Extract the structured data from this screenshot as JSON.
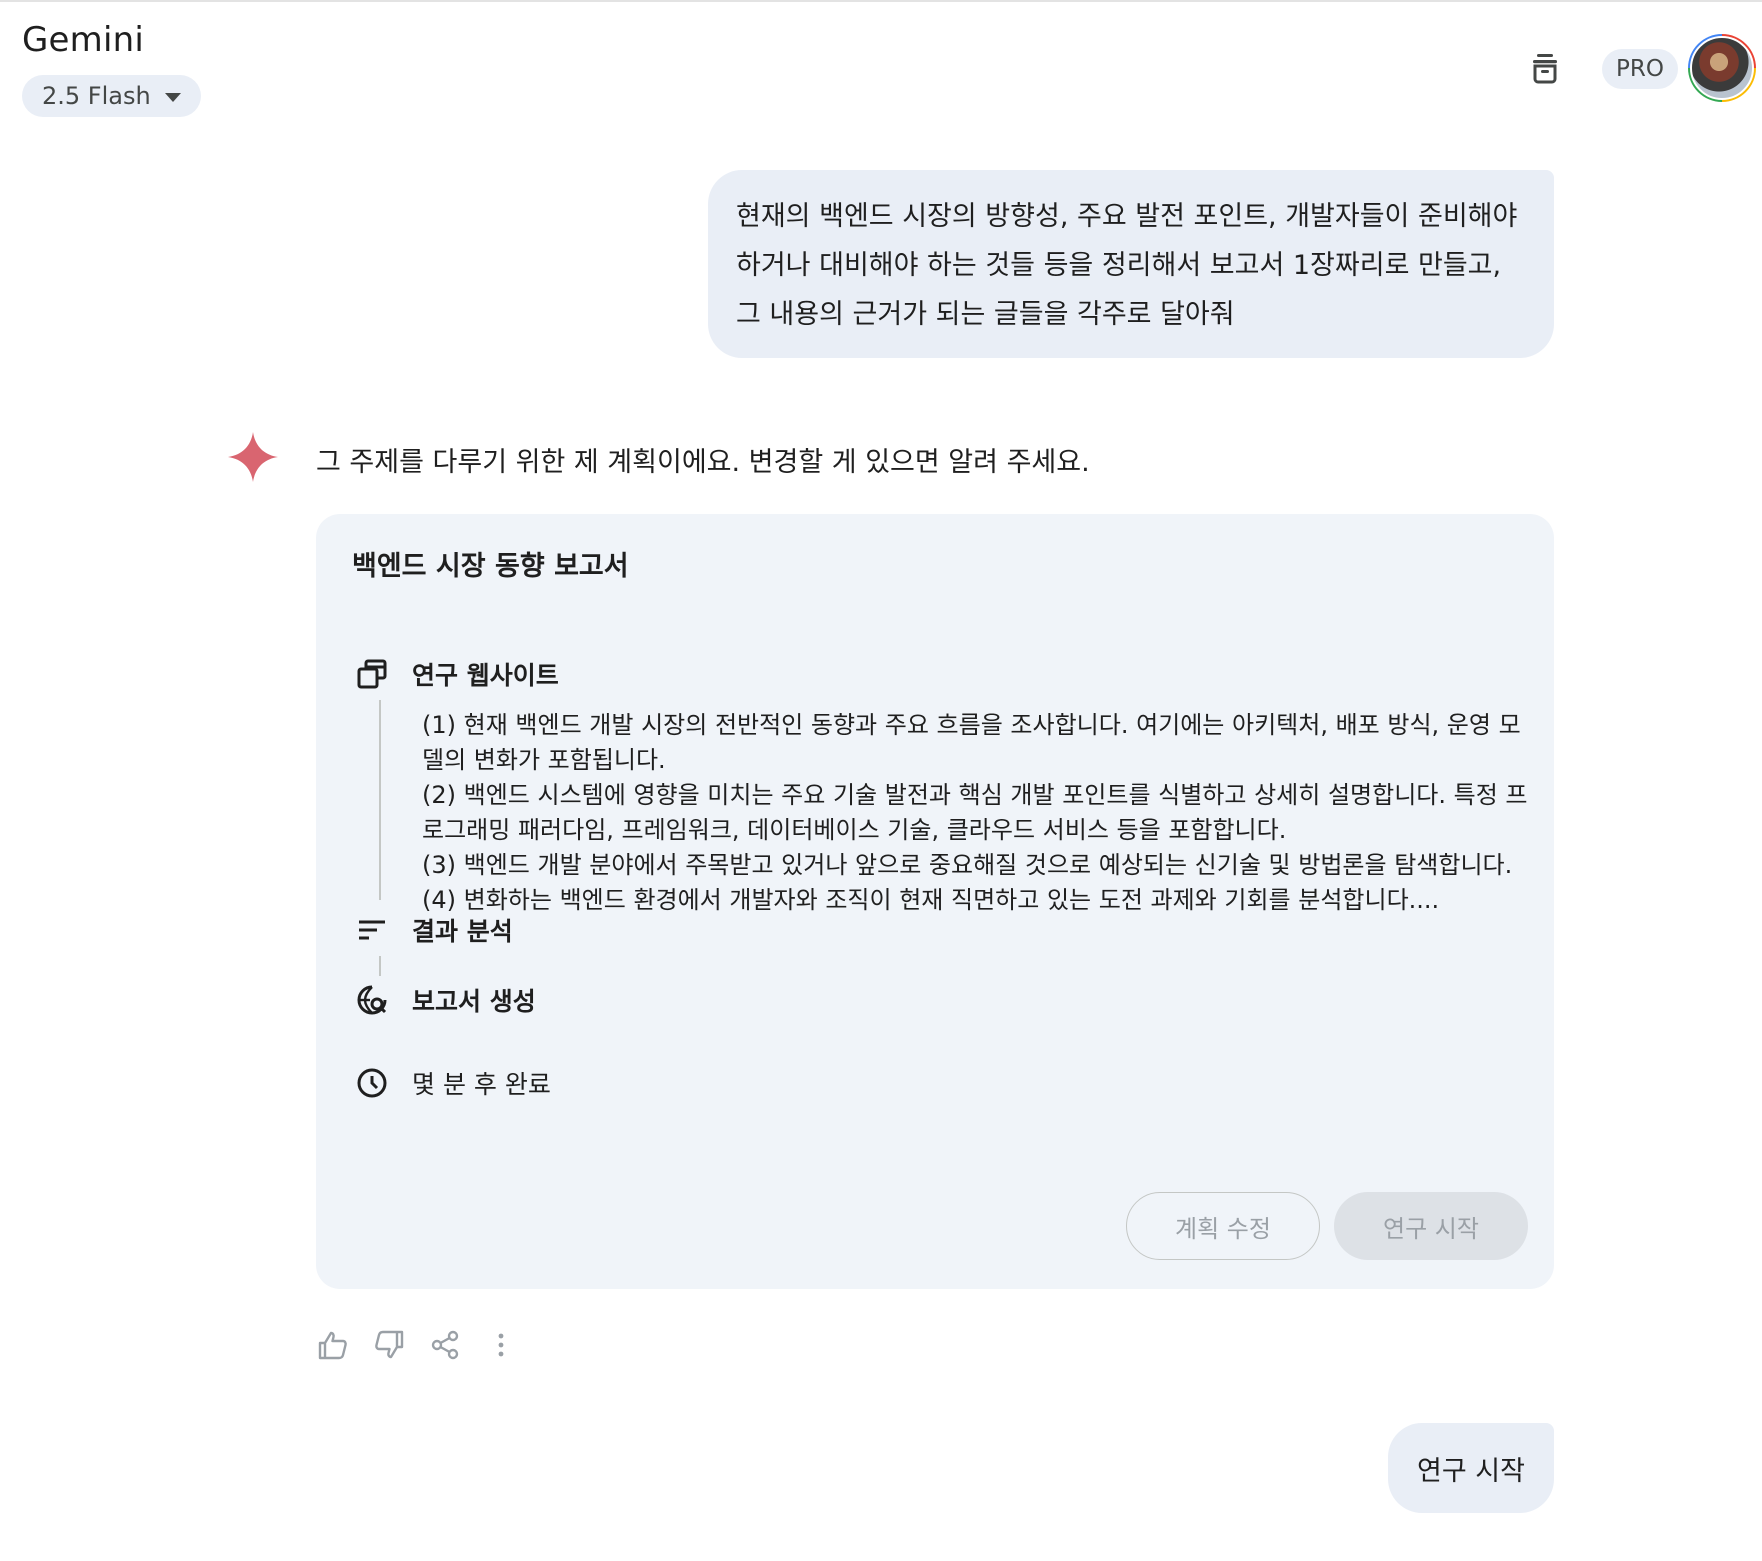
{
  "header": {
    "app_title": "Gemini",
    "model_label": "2.5 Flash",
    "pro_badge": "PRO"
  },
  "conversation": {
    "user_message_1": "현재의 백엔드 시장의 방향성, 주요 발전 포인트, 개발자들이 준비해야 하거나 대비해야 하는 것들 등을 정리해서 보고서 1장짜리로 만들고, 그 내용의 근거가 되는 글들을 각주로 달아줘",
    "assistant_intro": "그 주제를 다루기 위한 제 계획이에요. 변경할 게 있으면 알려 주세요.",
    "plan": {
      "title": "백엔드 시장 동향 보고서",
      "steps": [
        {
          "label": "연구 웹사이트",
          "icon": "browser-window-icon",
          "details": [
            "(1) 현재 백엔드 개발 시장의 전반적인 동향과 주요 흐름을 조사합니다. 여기에는 아키텍처, 배포 방식, 운영 모델의 변화가 포함됩니다.",
            "(2) 백엔드 시스템에 영향을 미치는 주요 기술 발전과 핵심 개발 포인트를 식별하고 상세히 설명합니다. 특정 프로그래밍 패러다임, 프레임워크, 데이터베이스 기술, 클라우드 서비스 등을 포함합니다.",
            "(3) 백엔드 개발 분야에서 주목받고 있거나 앞으로 중요해질 것으로 예상되는 신기술 및 방법론을 탐색합니다.",
            "(4) 변화하는 백엔드 환경에서 개발자와 조직이 현재 직면하고 있는 도전 과제와 기회를 분석합니다...."
          ]
        },
        {
          "label": "결과 분석",
          "icon": "sort-lines-icon"
        },
        {
          "label": "보고서 생성",
          "icon": "globe-search-icon"
        }
      ],
      "time_estimate": "몇 분 후 완료",
      "edit_button": "계획 수정",
      "start_button": "연구 시작"
    },
    "user_message_2": "연구 시작"
  },
  "colors": {
    "bubble": "#e9eef6",
    "card": "#f0f4f9",
    "sparkle": "#d96570",
    "disabled_text": "#9aa0a6"
  }
}
